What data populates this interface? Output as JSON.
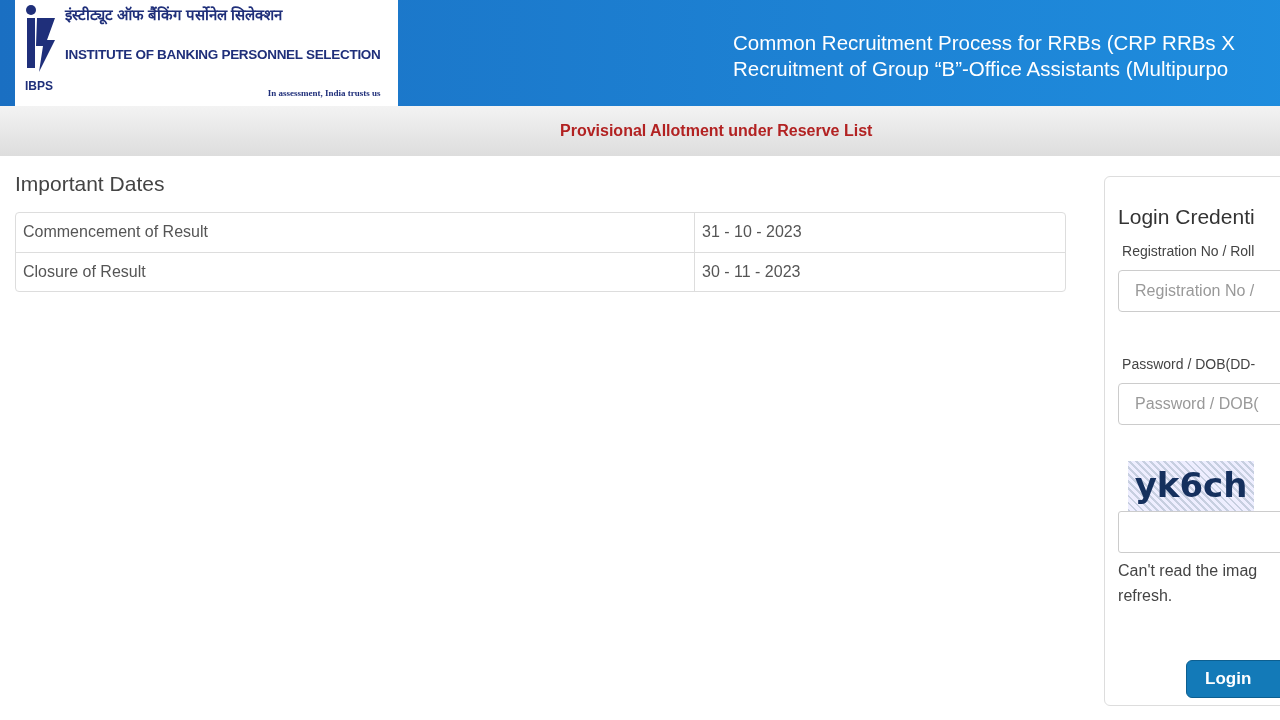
{
  "header": {
    "logo": {
      "abbr": "IBPS",
      "hindi_name": "इंस्टीट्यूट ऑफ बैंकिंग पर्सोनेल सिलेक्शन",
      "english_name": "INSTITUTE OF BANKING PERSONNEL SELECTION",
      "motto": "In assessment, India trusts us"
    },
    "title_lines": [
      "Common Recruitment Process for RRBs (CRP RRBs X",
      "Recruitment of Group “B”-Office Assistants (Multipurpo"
    ]
  },
  "notice_bar": "Provisional Allotment under Reserve List",
  "important_dates": {
    "heading": "Important Dates",
    "rows": [
      {
        "label": "Commencement of Result",
        "date": "31 - 10 - 2023"
      },
      {
        "label": "Closure of Result",
        "date": "30 - 11 - 2023"
      }
    ]
  },
  "login": {
    "heading": "Login Credenti",
    "fields": [
      {
        "label": "Registration No / Roll",
        "placeholder": "Registration No /"
      },
      {
        "label": "Password / DOB(DD-",
        "placeholder": "Password / DOB("
      }
    ],
    "captcha": "yk6ch",
    "captcha_help": "Can't read the imag refresh.",
    "button": "Login"
  }
}
